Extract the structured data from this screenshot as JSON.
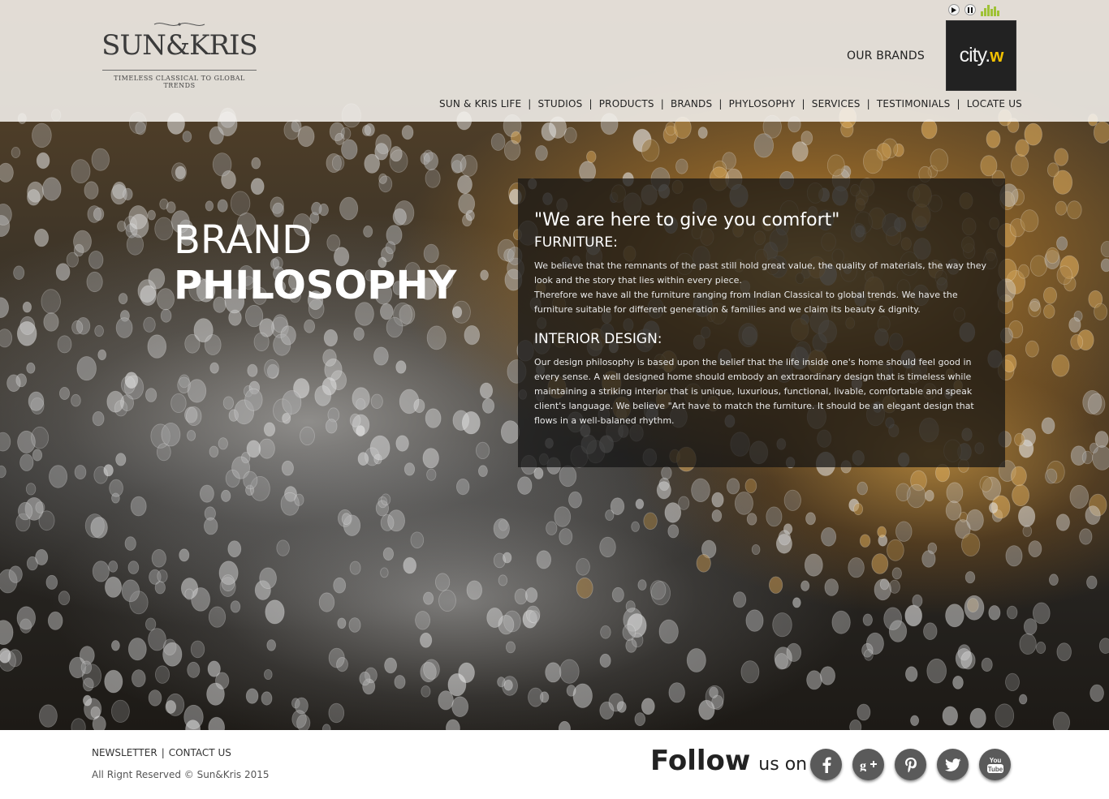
{
  "header": {
    "logo": {
      "name": "SUN&KRIS",
      "tagline": "TIMELESS CLASSICAL TO GLOBAL TRENDS"
    },
    "media_controls": {
      "play_icon": "play-icon",
      "pause_icon": "pause-icon",
      "equalizer_icon": "equalizer-icon"
    },
    "our_brands_label": "OUR BRANDS",
    "brand_logo": {
      "text": "city.",
      "accent": "w",
      "accent_color": "#f2c100"
    },
    "nav": [
      "SUN & KRIS LIFE",
      "STUDIOS",
      "PRODUCTS",
      "BRANDS",
      "PHYLOSOPHY",
      "SERVICES",
      "TESTIMONIALS",
      "LOCATE US"
    ]
  },
  "hero": {
    "title_light": "BRAND",
    "title_bold": "PHILOSOPHY",
    "quote": "\"We are here to give you comfort\"",
    "sections": [
      {
        "heading": "FURNITURE:",
        "paragraphs": [
          "We believe that the remnants of the past still hold great value, the quality of materials, the way they look and the story that lies within every piece.",
          "Therefore we have all the furniture ranging from Indian Classical to global trends. We have the furniture suitable for different generation & families and we claim its beauty & dignity."
        ]
      },
      {
        "heading": "INTERIOR DESIGN:",
        "paragraphs": [
          "Our design philosophy is based upon the belief that the life inside one's home should feel good in every sense. A well designed home should embody an extraordinary design that is timeless while maintaining a striking interior that is unique, luxurious, functional, livable, comfortable and speak client's language. We believe \"Art have to match the furniture. It should be an elegant design that flows in a well-balaned rhythm."
        ]
      }
    ]
  },
  "footer": {
    "links": [
      "NEWSLETTER",
      "CONTACT US"
    ],
    "copyright": "All Rignt Reserved © Sun&Kris 2015",
    "follow_big": "Follow",
    "follow_small": "us on",
    "social": [
      {
        "name": "facebook-icon",
        "glyph": "f"
      },
      {
        "name": "google-plus-icon",
        "glyph": "g+"
      },
      {
        "name": "pinterest-icon",
        "glyph": "P"
      },
      {
        "name": "twitter-icon",
        "glyph": "t"
      },
      {
        "name": "youtube-icon",
        "glyph": "You Tube"
      }
    ],
    "social_color": "#5a5a5a"
  }
}
